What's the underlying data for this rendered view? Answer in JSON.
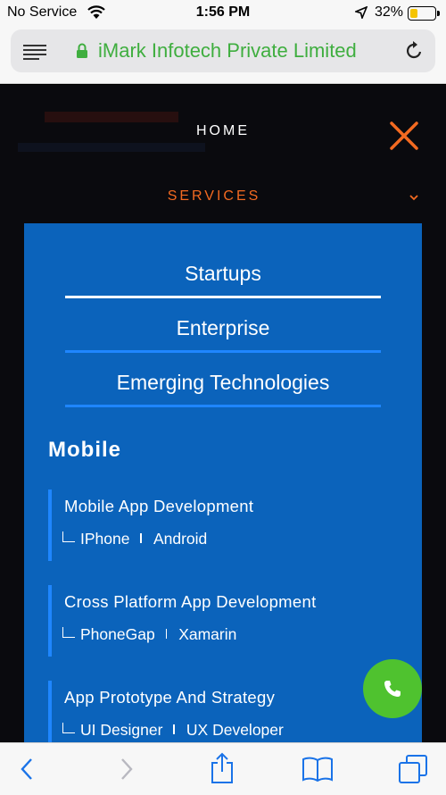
{
  "status_bar": {
    "carrier": "No Service",
    "time": "1:56 PM",
    "battery": "32%",
    "battery_level": 0.32
  },
  "browser": {
    "site_title": "iMark Infotech Private Limited",
    "icons": [
      "reader-icon",
      "lock-icon",
      "reload-icon"
    ]
  },
  "menu": {
    "home_label": "HOME",
    "services_label": "SERVICES",
    "services_color": "#f36a21"
  },
  "panel": {
    "tabs": [
      {
        "label": "Startups"
      },
      {
        "label": "Enterprise"
      },
      {
        "label": "Emerging Technologies"
      }
    ],
    "section_title": "Mobile",
    "cards": [
      {
        "title": "Mobile App Development",
        "links": [
          "IPhone",
          "Android"
        ]
      },
      {
        "title": "Cross Platform App Development",
        "links": [
          "PhoneGap",
          "Xamarin"
        ]
      },
      {
        "title": "App Prototype And Strategy",
        "links": [
          "UI Designer",
          "UX Developer"
        ]
      }
    ],
    "background": "#0b63bb",
    "accent": "#1f86ff"
  },
  "call_button": {
    "icon": "phone-icon",
    "color": "#4fc22f"
  },
  "toolbar": {
    "icons": [
      "back-icon",
      "forward-icon",
      "share-icon",
      "bookmarks-icon",
      "tabs-icon"
    ]
  }
}
